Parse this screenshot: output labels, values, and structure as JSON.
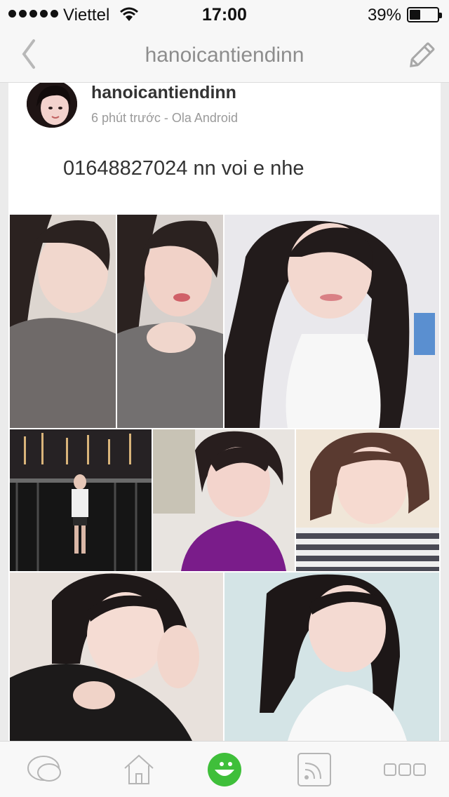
{
  "status_bar": {
    "carrier": "Viettel",
    "time": "17:00",
    "battery_percent": "39%",
    "battery_level": 0.39,
    "signal_bars": 5
  },
  "nav": {
    "title": "hanoicantiendinn",
    "back_icon": "chevron-left-icon",
    "edit_icon": "pencil-icon"
  },
  "post": {
    "author": "hanoicantiendinn",
    "meta": "6 phút trước - Ola Android",
    "text": "01648827024 nn voi e nhe",
    "photos": [
      {
        "name": "photo-1",
        "description": "selfie grey top"
      },
      {
        "name": "photo-2",
        "description": "selfie grey top pouting"
      },
      {
        "name": "photo-3",
        "description": "selfie white halter top"
      },
      {
        "name": "photo-4",
        "description": "night city railing"
      },
      {
        "name": "photo-5",
        "description": "selfie purple top"
      },
      {
        "name": "photo-6",
        "description": "selfie striped top"
      },
      {
        "name": "photo-7",
        "description": "selfie black top"
      },
      {
        "name": "photo-8",
        "description": "selfie white top"
      }
    ]
  },
  "tab_bar": {
    "tabs": [
      {
        "icon": "chat-bubble-icon",
        "active": false
      },
      {
        "icon": "home-icon",
        "active": false
      },
      {
        "icon": "smiley-icon",
        "active": true
      },
      {
        "icon": "feed-icon",
        "active": false
      },
      {
        "icon": "more-icon",
        "active": false
      }
    ],
    "accent_color": "#3fbf3a"
  }
}
